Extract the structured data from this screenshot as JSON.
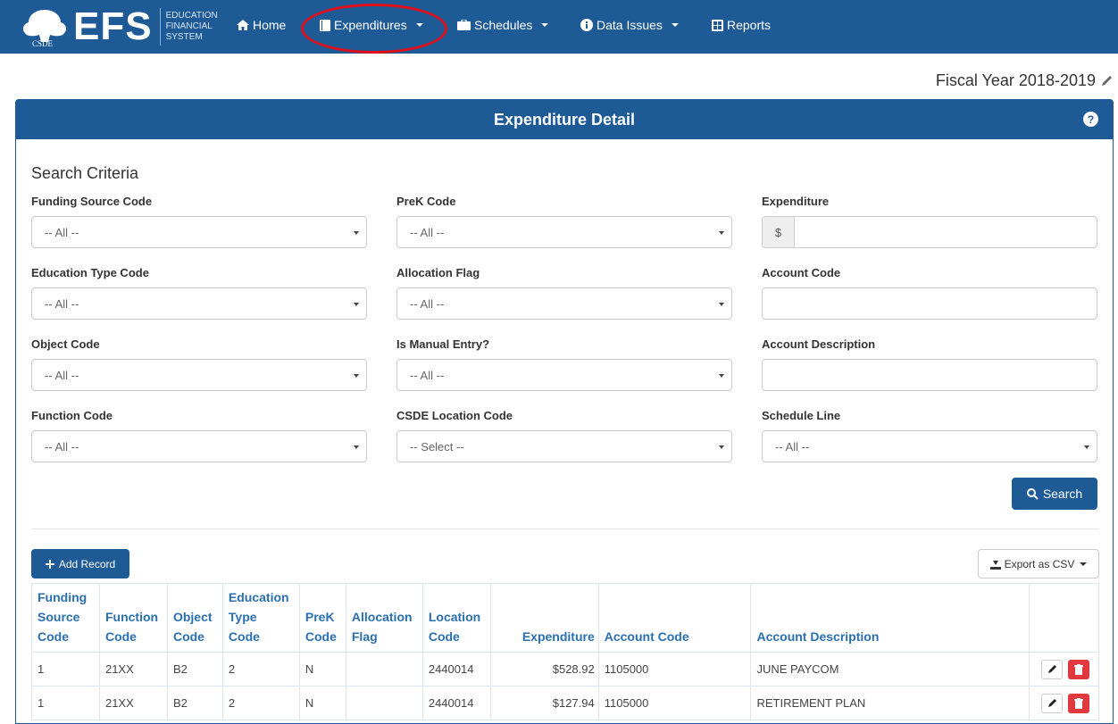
{
  "logo": {
    "main": "EFS",
    "sub_lines": [
      "EDUCATION",
      "FINANCIAL",
      "SYSTEM"
    ],
    "tree_caption": "CSDE"
  },
  "nav": {
    "home": "Home",
    "expenditures": "Expenditures",
    "schedules": "Schedules",
    "data_issues": "Data Issues",
    "reports": "Reports"
  },
  "fiscal_year": "Fiscal Year 2018-2019",
  "panel": {
    "title": "Expenditure Detail"
  },
  "criteria": {
    "title": "Search Criteria",
    "funding_source": {
      "label": "Funding Source Code",
      "value": "-- All --"
    },
    "prek": {
      "label": "PreK Code",
      "value": "-- All --"
    },
    "expenditure": {
      "label": "Expenditure",
      "addon": "$",
      "value": ""
    },
    "education_type": {
      "label": "Education Type Code",
      "value": "-- All --"
    },
    "allocation_flag": {
      "label": "Allocation Flag",
      "value": "-- All --"
    },
    "account_code": {
      "label": "Account Code",
      "value": ""
    },
    "object_code": {
      "label": "Object Code",
      "value": "-- All --"
    },
    "manual_entry": {
      "label": "Is Manual Entry?",
      "value": "-- All --"
    },
    "account_description": {
      "label": "Account Description",
      "value": ""
    },
    "function_code": {
      "label": "Function Code",
      "value": "-- All --"
    },
    "location_code": {
      "label": "CSDE Location Code",
      "value": "-- Select --"
    },
    "schedule_line": {
      "label": "Schedule Line",
      "value": "-- All --"
    },
    "search_button": "Search"
  },
  "toolbar": {
    "add_record": "Add Record",
    "export_csv": "Export as CSV"
  },
  "table": {
    "headers": {
      "funding": [
        "Funding",
        "Source",
        "Code"
      ],
      "function": [
        "Function",
        "Code"
      ],
      "object": [
        "Object",
        "Code"
      ],
      "education": [
        "Education",
        "Type",
        "Code"
      ],
      "prek": [
        "PreK",
        "Code"
      ],
      "allocation": [
        "Allocation",
        "Flag"
      ],
      "location": [
        "Location",
        "Code"
      ],
      "expenditure": "Expenditure",
      "account_code": "Account Code",
      "account_description": "Account Description"
    },
    "rows": [
      {
        "funding": "1",
        "function": "21XX",
        "object": "B2",
        "education": "2",
        "prek": "N",
        "allocation": "",
        "location": "2440014",
        "expenditure": "$528.92",
        "account_code": "1105000",
        "account_description": "JUNE PAYCOM"
      },
      {
        "funding": "1",
        "function": "21XX",
        "object": "B2",
        "education": "2",
        "prek": "N",
        "allocation": "",
        "location": "2440014",
        "expenditure": "$127.94",
        "account_code": "1105000",
        "account_description": "RETIREMENT PLAN"
      }
    ]
  },
  "colors": {
    "brand": "#1d5a96",
    "header_text": "#2a6fb0",
    "delete": "#e2383f",
    "annotation": "#e0101a"
  }
}
